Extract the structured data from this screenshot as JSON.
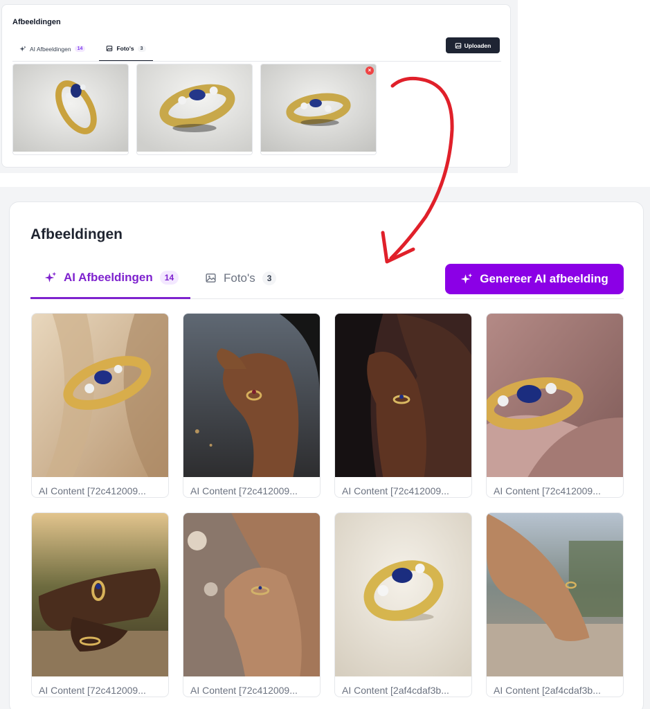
{
  "top_panel": {
    "title": "Afbeeldingen",
    "tabs": [
      {
        "label": "AI Afbeeldingen",
        "count": "14"
      },
      {
        "label": "Foto's",
        "count": "3"
      }
    ],
    "upload_label": "Uploaden",
    "photos": [
      {
        "icon": "photo-ring-thumbnail"
      },
      {
        "icon": "photo-ring-thumbnail"
      },
      {
        "icon": "photo-ring-thumbnail",
        "remove_icon": "close-icon"
      }
    ]
  },
  "main_panel": {
    "title": "Afbeeldingen",
    "tabs": [
      {
        "label": "AI Afbeeldingen",
        "count": "14",
        "icon": "sparkles-icon"
      },
      {
        "label": "Foto's",
        "count": "3",
        "icon": "image-icon"
      }
    ],
    "generate_label": "Genereer AI afbeelding",
    "items": [
      {
        "caption": "AI Content [72c412009..."
      },
      {
        "caption": "AI Content [72c412009..."
      },
      {
        "caption": "AI Content [72c412009..."
      },
      {
        "caption": "AI Content [72c412009..."
      },
      {
        "caption": "AI Content [72c412009..."
      },
      {
        "caption": "AI Content [72c412009..."
      },
      {
        "caption": "AI Content [2af4cdaf3b..."
      },
      {
        "caption": "AI Content [2af4cdaf3b..."
      }
    ]
  },
  "colors": {
    "accent_purple": "#8b00e6",
    "tab_active": "#7e22ce",
    "upload_dark": "#1e2433",
    "arrow_red": "#e0202a",
    "remove_red": "#ef4444"
  }
}
